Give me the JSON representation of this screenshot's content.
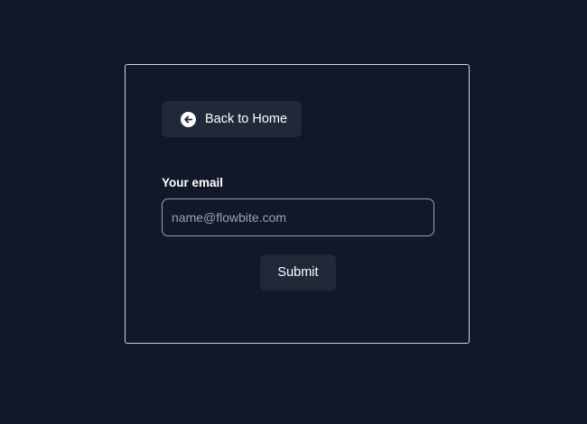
{
  "back_button": {
    "label": "Back to Home",
    "icon": "arrow-left-circle-icon"
  },
  "email_field": {
    "label": "Your email",
    "placeholder": "name@flowbite.com",
    "value": ""
  },
  "submit_button": {
    "label": "Submit"
  },
  "colors": {
    "background": "#111827",
    "button_bg": "#1f2937",
    "card_border": "#d1d5db",
    "input_border": "#9ca3af",
    "text": "#ffffff",
    "placeholder": "#9ca3af"
  }
}
